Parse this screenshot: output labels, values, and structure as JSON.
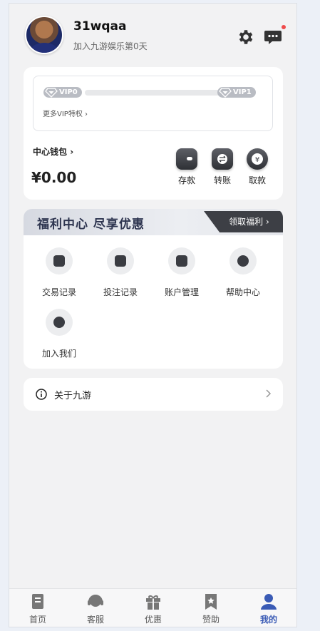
{
  "profile": {
    "username": "31wqaa",
    "joined": "加入九游娱乐第0天"
  },
  "vip": {
    "current": "VIP0",
    "next": "VIP1",
    "progress": 0,
    "more": "更多VIP特权"
  },
  "wallet": {
    "title": "中心钱包",
    "amount": "¥0.00",
    "actions": [
      "存款",
      "转账",
      "取款"
    ]
  },
  "welfare": {
    "title": "福利中心 尽享优惠",
    "claim": "领取福利",
    "items": [
      "交易记录",
      "投注记录",
      "账户管理",
      "帮助中心",
      "加入我们"
    ]
  },
  "about": {
    "label": "关于九游"
  },
  "tabs": [
    {
      "label": "首页",
      "icon": "home-icon"
    },
    {
      "label": "客服",
      "icon": "headset-icon"
    },
    {
      "label": "优惠",
      "icon": "gift-icon"
    },
    {
      "label": "赞助",
      "icon": "bookmark-star-icon"
    },
    {
      "label": "我的",
      "icon": "user-icon",
      "active": true
    }
  ],
  "colors": {
    "accent": "#3a5bb5",
    "notification": "#ef4b4b",
    "dark_button": "#3d3f45"
  }
}
